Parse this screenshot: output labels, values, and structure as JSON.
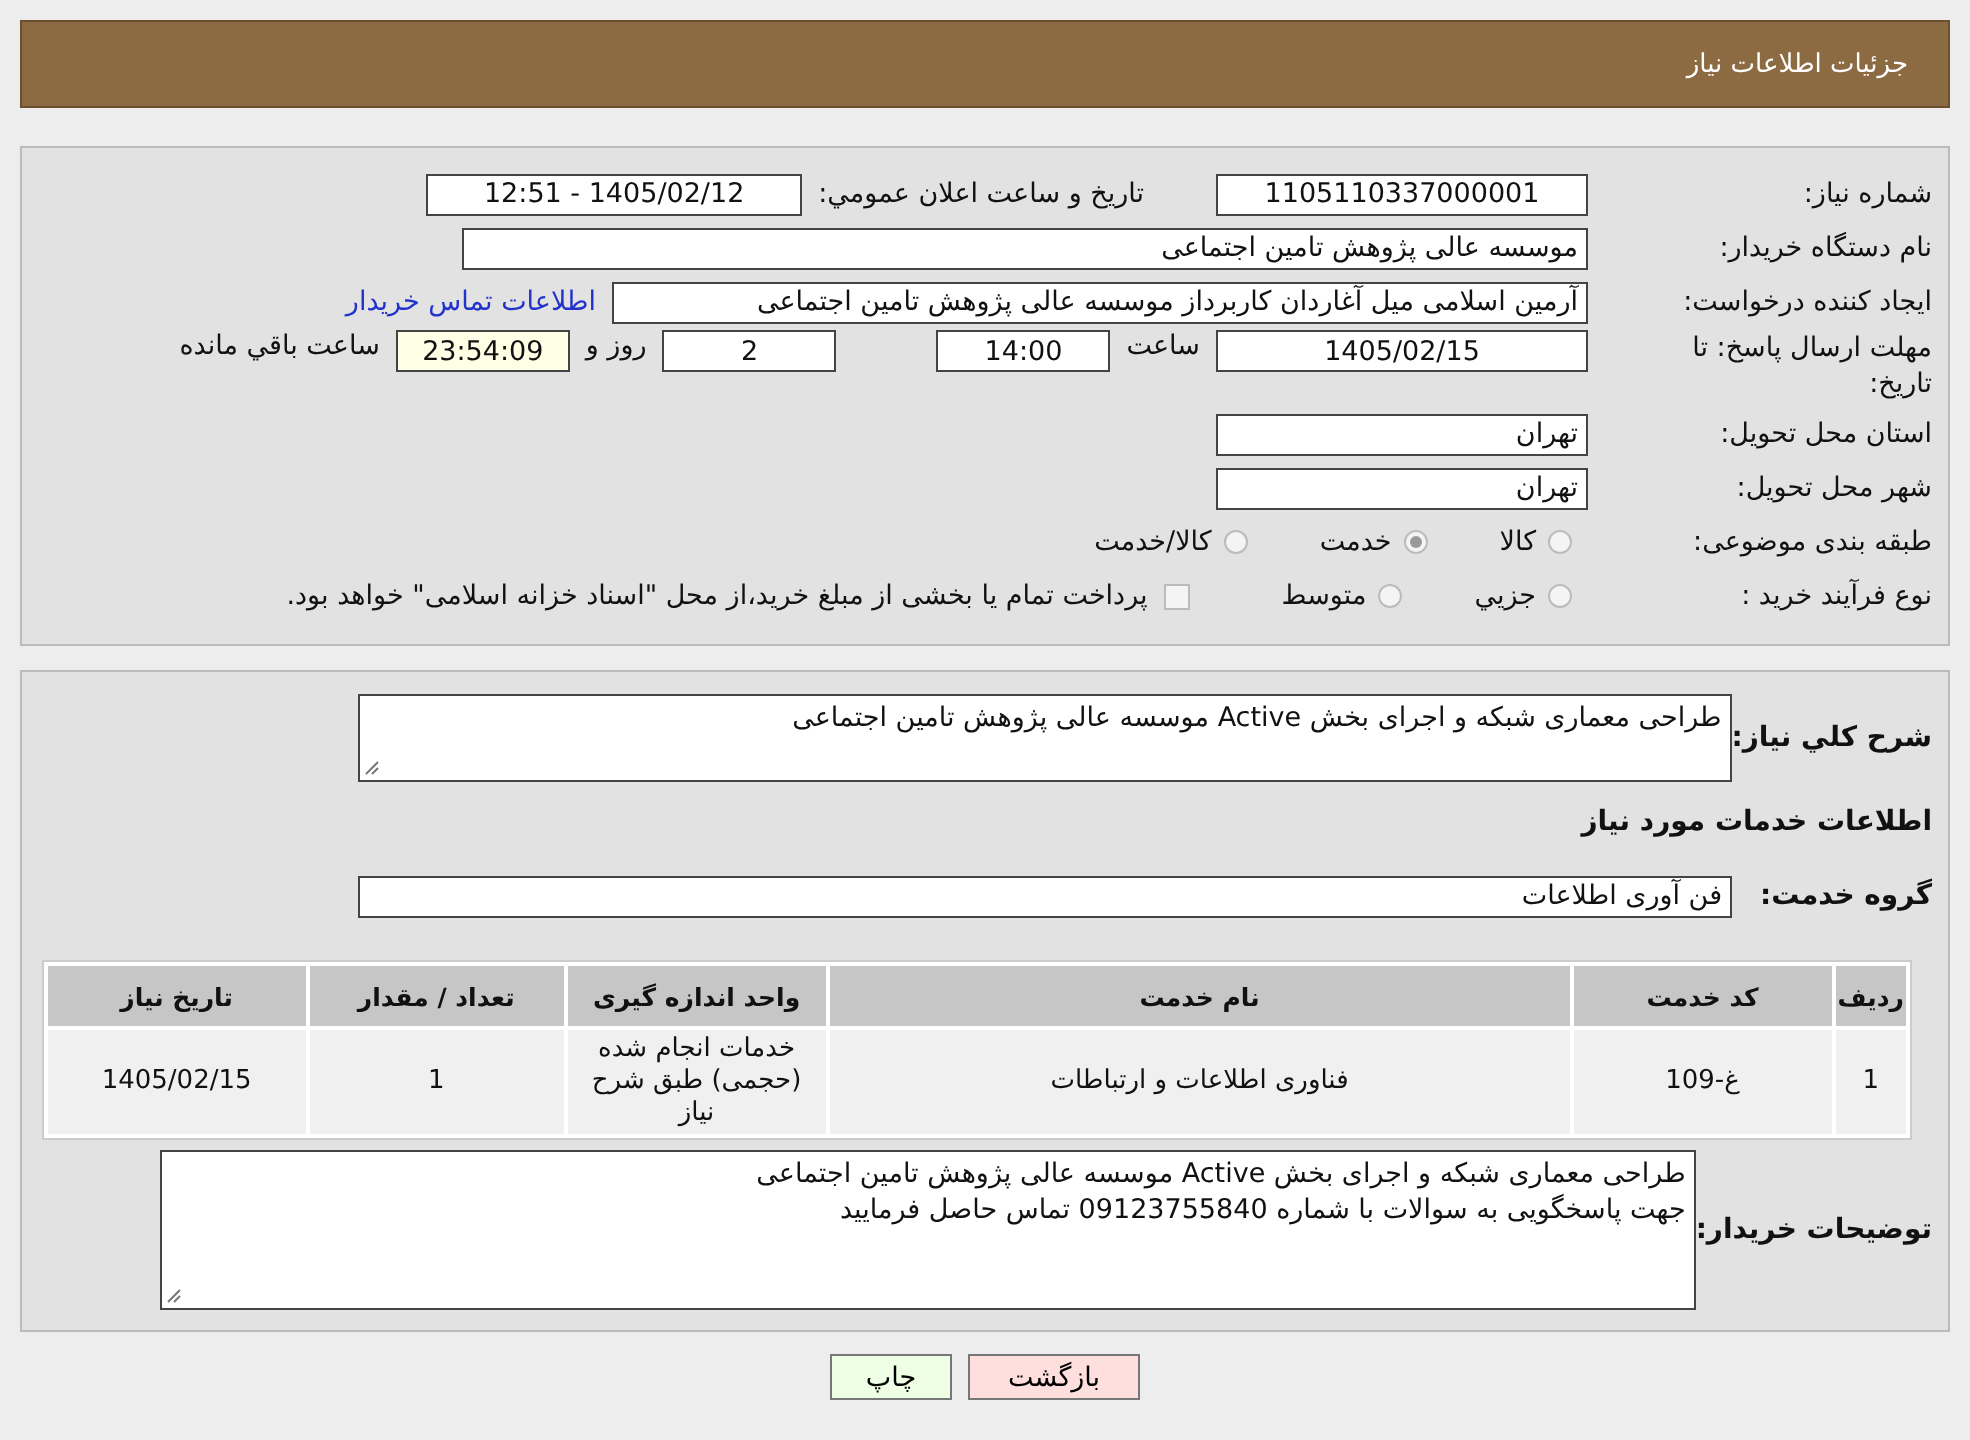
{
  "header": {
    "title": "جزئیات اطلاعات نیاز"
  },
  "need_number": {
    "label": "شماره نیاز:",
    "value": "1105110337000001"
  },
  "announce": {
    "label": "تاريخ و ساعت اعلان عمومي:",
    "value": "1405/02/12 - 12:51"
  },
  "buyer": {
    "label": "نام دستگاه خريدار:",
    "value": "موسسه عالی پژوهش تامین اجتماعی"
  },
  "requester": {
    "label": "ايجاد کننده درخواست:",
    "value": "آرمین اسلامی میل آغاردان کاربرداز موسسه عالی پژوهش تامین اجتماعی",
    "link": "اطلاعات تماس خريدار"
  },
  "deadline": {
    "label": "مهلت ارسال پاسخ: تا تاریخ:",
    "date": "1405/02/15",
    "time_label": "ساعت",
    "time": "14:00",
    "days": "2",
    "days_label": "روز و",
    "remaining": "23:54:09",
    "remaining_label": "ساعت باقي مانده"
  },
  "province": {
    "label": "استان محل تحویل:",
    "value": "تهران"
  },
  "city": {
    "label": "شهر محل تحویل:",
    "value": "تهران"
  },
  "category": {
    "label": "طبقه بندی موضوعی:",
    "options": [
      {
        "label": "کالا",
        "selected": false
      },
      {
        "label": "خدمت",
        "selected": true
      },
      {
        "label": "کالا/خدمت",
        "selected": false
      }
    ]
  },
  "process": {
    "label": "نوع فرآيند خريد :",
    "options": [
      {
        "label": "جزيي",
        "selected": false
      },
      {
        "label": "متوسط",
        "selected": false
      }
    ],
    "payment": {
      "text": "پرداخت تمام یا بخشی از مبلغ خرید،از محل \"اسناد خزانه اسلامی\" خواهد بود.",
      "checked": false
    }
  },
  "description": {
    "label": "شرح کلي نياز:",
    "value": "طراحی معماری شبکه و اجرای بخش Active موسسه عالی پژوهش تامین اجتماعی"
  },
  "services_title": "اطلاعات خدمات مورد نياز",
  "service_group": {
    "label": "گروه خدمت:",
    "value": "فن آوری اطلاعات"
  },
  "table": {
    "columns": [
      "رديف",
      "کد خدمت",
      "نام خدمت",
      "واحد اندازه گيری",
      "تعداد / مقدار",
      "تاريخ نياز"
    ],
    "rows": [
      [
        "1",
        "غ-109",
        "فناوری اطلاعات و ارتباطات",
        "خدمات انجام شده (حجمی) طبق شرح نیاز",
        "1",
        "1405/02/15"
      ]
    ]
  },
  "buyer_notes": {
    "label": "توضيحات خريدار:",
    "lines": [
      "طراحی معماری شبکه و اجرای بخش Active موسسه عالی پژوهش تامین اجتماعی",
      "جهت پاسخگویی به سوالات با شماره 09123755840 تماس حاصل فرمایید"
    ]
  },
  "buttons": [
    {
      "label": "بازگشت",
      "kind": "back"
    },
    {
      "label": "چاپ",
      "kind": "print"
    }
  ]
}
